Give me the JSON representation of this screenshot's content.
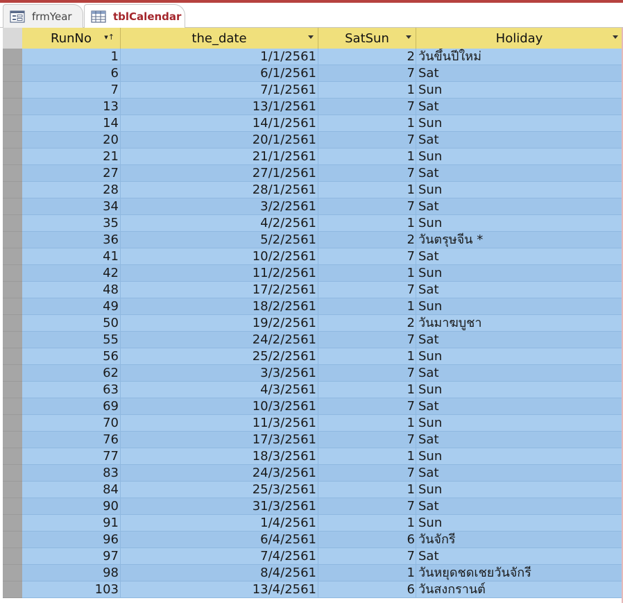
{
  "tabs": [
    {
      "label": "frmYear",
      "icon": "form-icon",
      "active": false
    },
    {
      "label": "tblCalendar",
      "icon": "table-icon",
      "active": true
    }
  ],
  "columns": [
    {
      "key": "runno",
      "label": "RunNo",
      "sorted": true
    },
    {
      "key": "the_date",
      "label": "the_date",
      "sorted": false
    },
    {
      "key": "satsun",
      "label": "SatSun",
      "sorted": false
    },
    {
      "key": "holiday",
      "label": "Holiday",
      "sorted": false
    }
  ],
  "rows": [
    {
      "runno": "1",
      "the_date": "1/1/2561",
      "satsun": "2",
      "holiday": "วันขึ้นปีใหม่"
    },
    {
      "runno": "6",
      "the_date": "6/1/2561",
      "satsun": "7",
      "holiday": "Sat"
    },
    {
      "runno": "7",
      "the_date": "7/1/2561",
      "satsun": "1",
      "holiday": "Sun"
    },
    {
      "runno": "13",
      "the_date": "13/1/2561",
      "satsun": "7",
      "holiday": "Sat"
    },
    {
      "runno": "14",
      "the_date": "14/1/2561",
      "satsun": "1",
      "holiday": "Sun"
    },
    {
      "runno": "20",
      "the_date": "20/1/2561",
      "satsun": "7",
      "holiday": "Sat"
    },
    {
      "runno": "21",
      "the_date": "21/1/2561",
      "satsun": "1",
      "holiday": "Sun"
    },
    {
      "runno": "27",
      "the_date": "27/1/2561",
      "satsun": "7",
      "holiday": "Sat"
    },
    {
      "runno": "28",
      "the_date": "28/1/2561",
      "satsun": "1",
      "holiday": "Sun"
    },
    {
      "runno": "34",
      "the_date": "3/2/2561",
      "satsun": "7",
      "holiday": "Sat"
    },
    {
      "runno": "35",
      "the_date": "4/2/2561",
      "satsun": "1",
      "holiday": "Sun"
    },
    {
      "runno": "36",
      "the_date": "5/2/2561",
      "satsun": "2",
      "holiday": "วันตรุษจีน *"
    },
    {
      "runno": "41",
      "the_date": "10/2/2561",
      "satsun": "7",
      "holiday": "Sat"
    },
    {
      "runno": "42",
      "the_date": "11/2/2561",
      "satsun": "1",
      "holiday": "Sun"
    },
    {
      "runno": "48",
      "the_date": "17/2/2561",
      "satsun": "7",
      "holiday": "Sat"
    },
    {
      "runno": "49",
      "the_date": "18/2/2561",
      "satsun": "1",
      "holiday": "Sun"
    },
    {
      "runno": "50",
      "the_date": "19/2/2561",
      "satsun": "2",
      "holiday": "วันมาฆบูชา"
    },
    {
      "runno": "55",
      "the_date": "24/2/2561",
      "satsun": "7",
      "holiday": "Sat"
    },
    {
      "runno": "56",
      "the_date": "25/2/2561",
      "satsun": "1",
      "holiday": "Sun"
    },
    {
      "runno": "62",
      "the_date": "3/3/2561",
      "satsun": "7",
      "holiday": "Sat"
    },
    {
      "runno": "63",
      "the_date": "4/3/2561",
      "satsun": "1",
      "holiday": "Sun"
    },
    {
      "runno": "69",
      "the_date": "10/3/2561",
      "satsun": "7",
      "holiday": "Sat"
    },
    {
      "runno": "70",
      "the_date": "11/3/2561",
      "satsun": "1",
      "holiday": "Sun"
    },
    {
      "runno": "76",
      "the_date": "17/3/2561",
      "satsun": "7",
      "holiday": "Sat"
    },
    {
      "runno": "77",
      "the_date": "18/3/2561",
      "satsun": "1",
      "holiday": "Sun"
    },
    {
      "runno": "83",
      "the_date": "24/3/2561",
      "satsun": "7",
      "holiday": "Sat"
    },
    {
      "runno": "84",
      "the_date": "25/3/2561",
      "satsun": "1",
      "holiday": "Sun"
    },
    {
      "runno": "90",
      "the_date": "31/3/2561",
      "satsun": "7",
      "holiday": "Sat"
    },
    {
      "runno": "91",
      "the_date": "1/4/2561",
      "satsun": "1",
      "holiday": "Sun"
    },
    {
      "runno": "96",
      "the_date": "6/4/2561",
      "satsun": "6",
      "holiday": "วันจักรี"
    },
    {
      "runno": "97",
      "the_date": "7/4/2561",
      "satsun": "7",
      "holiday": "Sat"
    },
    {
      "runno": "98",
      "the_date": "8/4/2561",
      "satsun": "1",
      "holiday": "วันหยุดชดเชยวันจักรี"
    },
    {
      "runno": "103",
      "the_date": "13/4/2561",
      "satsun": "6",
      "holiday": "วันสงกรานต์"
    }
  ],
  "colors": {
    "accent": "#a4262c",
    "header": "#f0e07c",
    "row_selected": "#a9cdef",
    "record_selector": "#a6a6a6"
  }
}
